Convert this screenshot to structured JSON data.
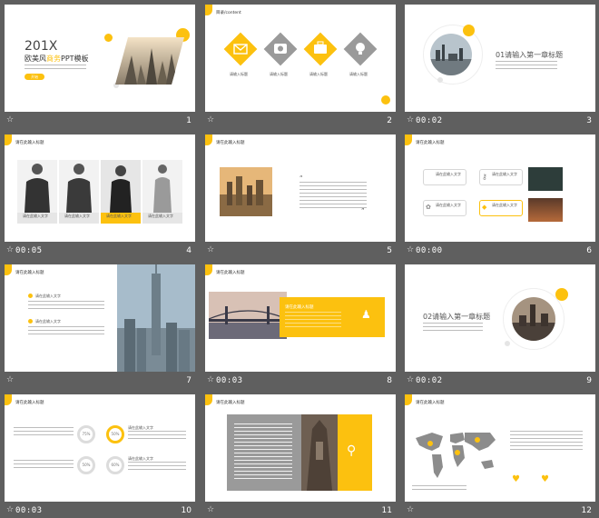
{
  "slides": [
    {
      "num": "1",
      "timing": "",
      "title_line1": "201X",
      "title_line2a": "欧美风",
      "title_line2b": "商务",
      "title_line2c": "PPT模板",
      "button": "开始"
    },
    {
      "num": "2",
      "timing": "",
      "header": "目录/content",
      "items": [
        "请输入标题",
        "请输入标题",
        "请输入标题",
        "请输入标题"
      ]
    },
    {
      "num": "3",
      "timing": "00:02",
      "title": "01请输入第一章标题"
    },
    {
      "num": "4",
      "timing": "00:05",
      "header": "请在此输入标题",
      "captions": [
        "请在此输入文字",
        "请在此输入文字",
        "请在此输入文字",
        "请在此输入文字"
      ]
    },
    {
      "num": "5",
      "timing": "",
      "header": "请在此输入标题"
    },
    {
      "num": "6",
      "timing": "00:00",
      "header": "请在此输入标题",
      "labels": [
        "请在此输入文字",
        "请在此输入文字",
        "请在此输入文字",
        "请在此输入文字"
      ]
    },
    {
      "num": "7",
      "timing": "",
      "header": "请在此输入标题",
      "labels": [
        "请在此输入文字",
        "请在此输入文字"
      ]
    },
    {
      "num": "8",
      "timing": "00:03",
      "header": "请在此输入标题",
      "panel_title": "请在此输入标题"
    },
    {
      "num": "9",
      "timing": "00:02",
      "title": "02请输入第一章标题"
    },
    {
      "num": "10",
      "timing": "00:03",
      "header": "请在此输入标题",
      "rings": [
        "75%",
        "50%",
        "50%",
        "60%"
      ],
      "labels": [
        "请在此输入文字",
        "请在此输入文字",
        "请在此输入文字",
        "请在此输入文字"
      ]
    },
    {
      "num": "11",
      "timing": "",
      "header": "请在此输入标题"
    },
    {
      "num": "12",
      "timing": "",
      "header": "请在此输入标题"
    }
  ],
  "colors": {
    "accent": "#fcc10f",
    "background": "#5f5f5f",
    "footer_text": "#ffffff"
  },
  "icons": [
    "star-icon",
    "mail-icon",
    "camera-icon",
    "briefcase-icon",
    "bulb-icon",
    "key-icon",
    "paw-icon",
    "tag-icon",
    "user-icon",
    "search-icon",
    "map-pin-icon"
  ]
}
